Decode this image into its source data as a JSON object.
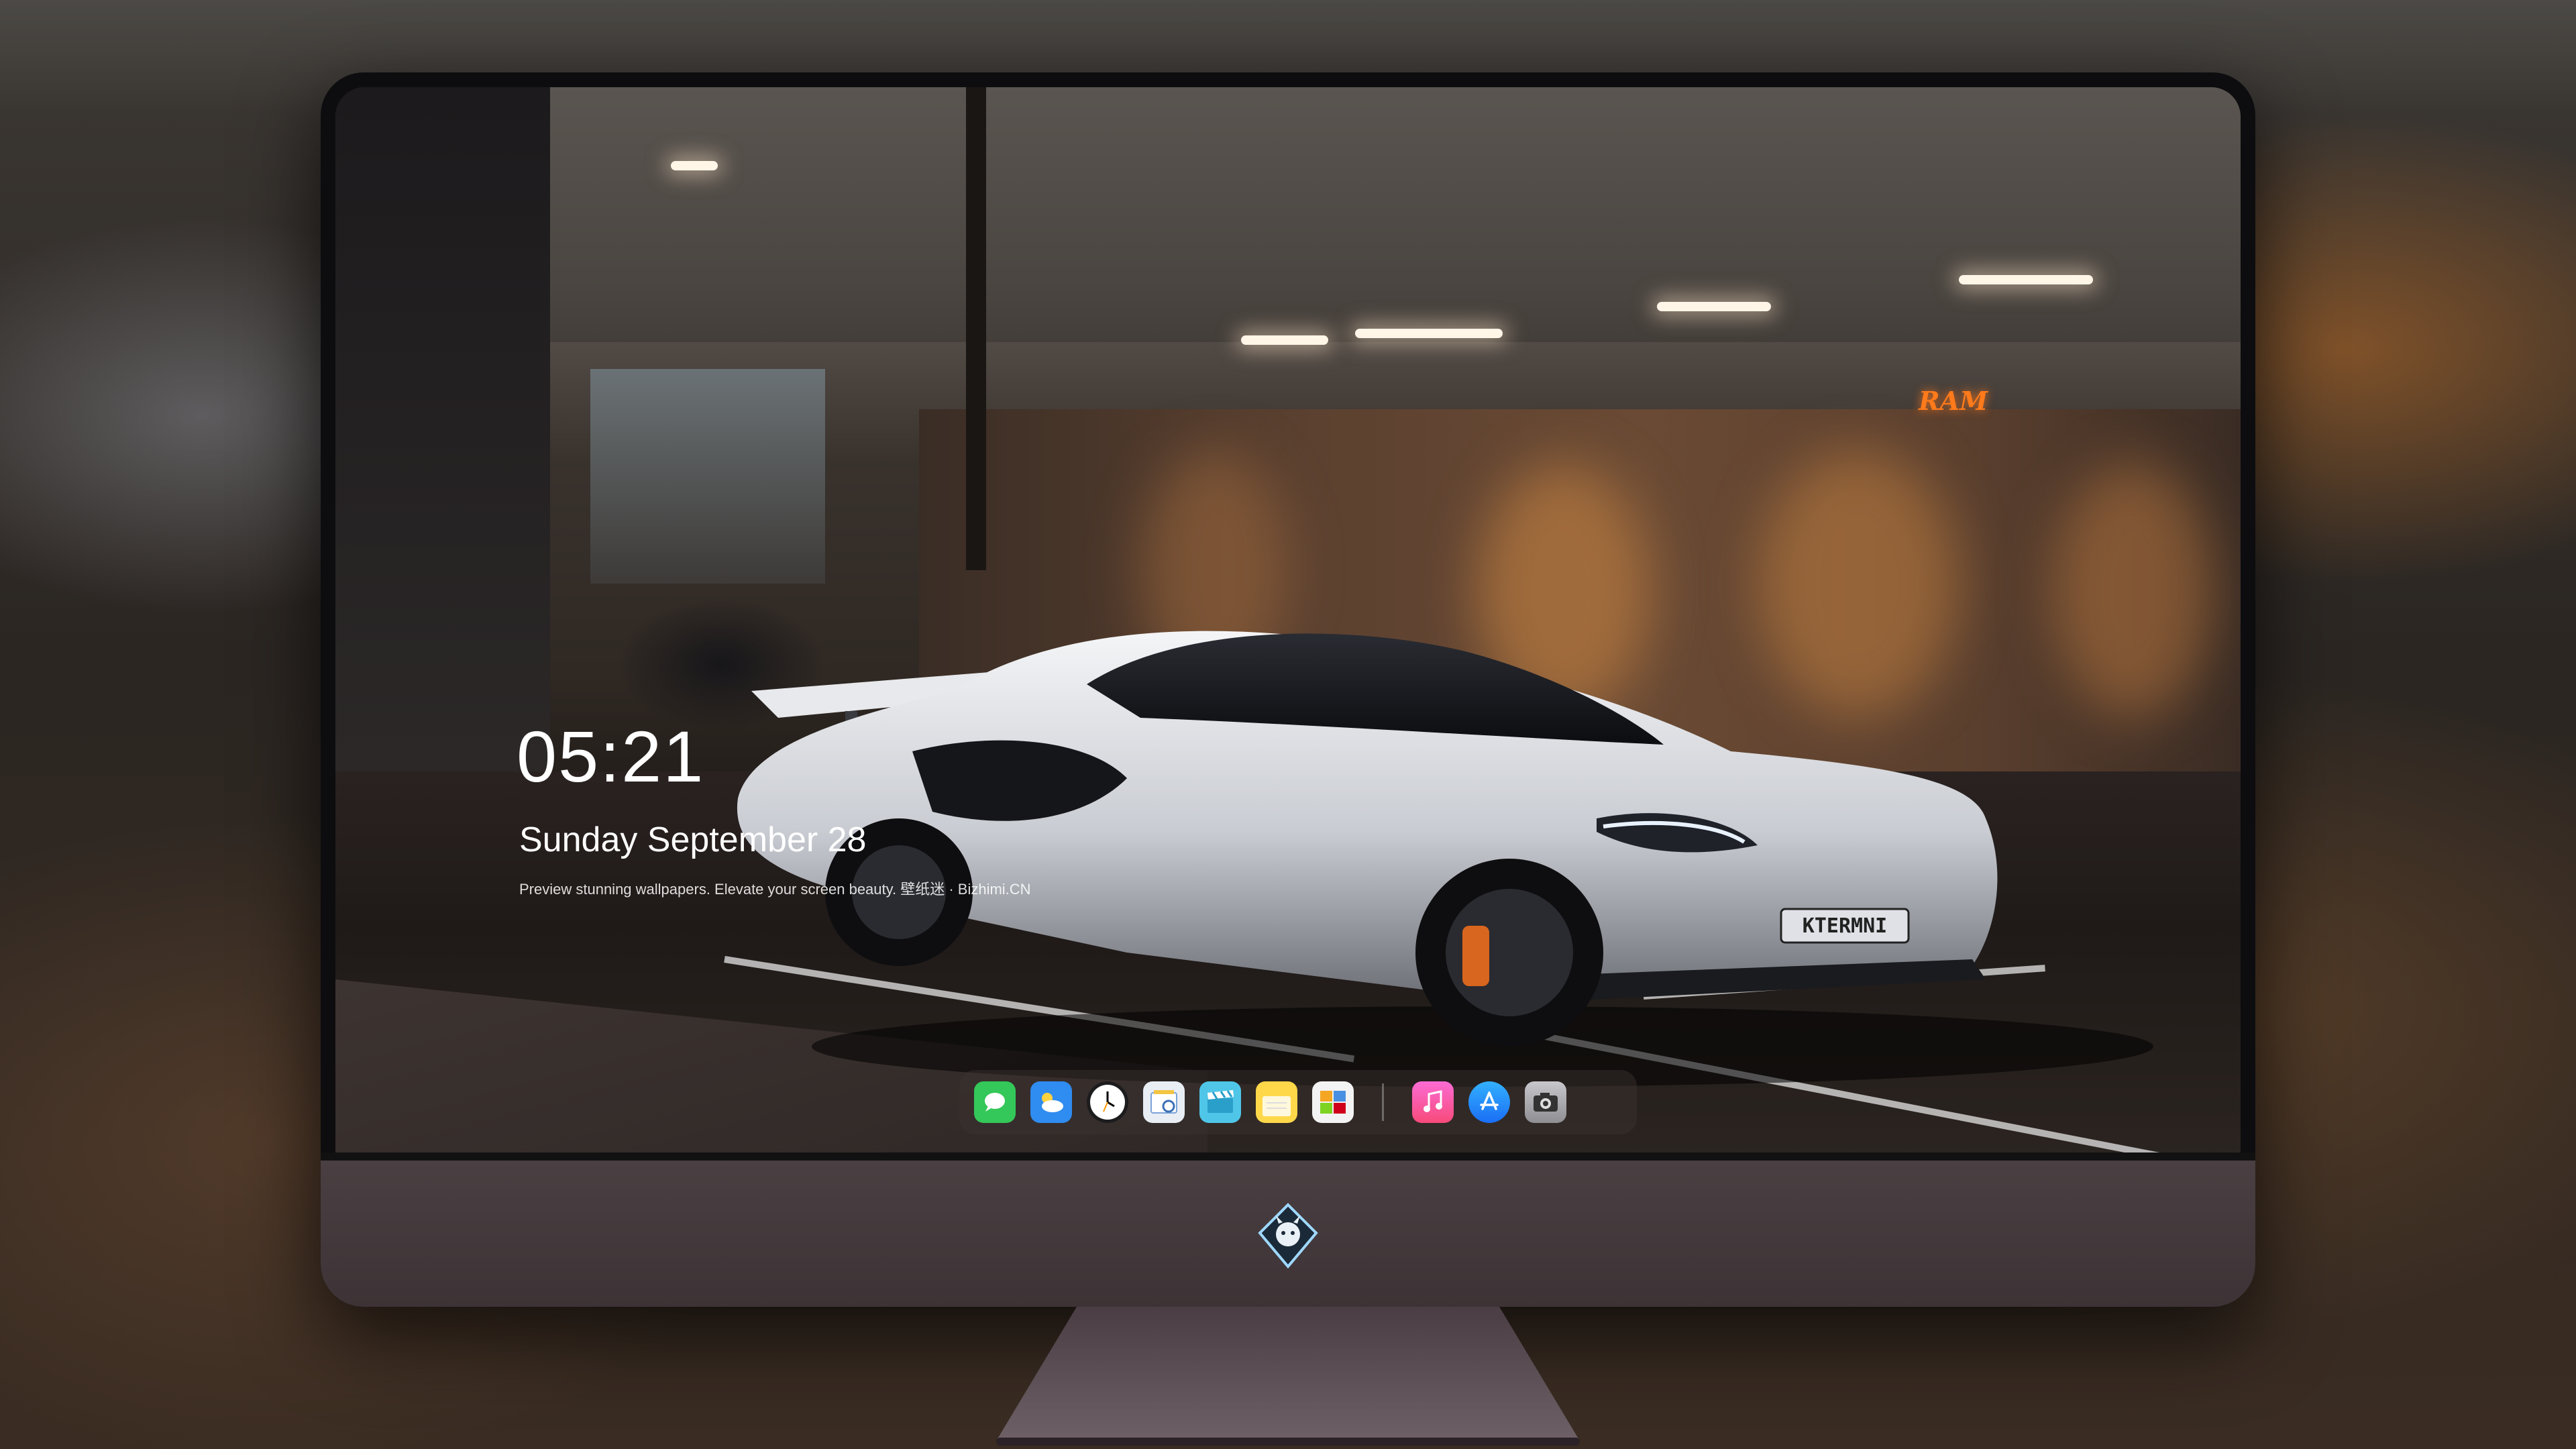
{
  "lock_screen": {
    "time": "05:21",
    "date": "Sunday September  28",
    "tagline": "Preview stunning wallpapers. Elevate your screen beauty. 壁纸迷 · Bizhimi.CN"
  },
  "wallpaper": {
    "sign_text": "RAM",
    "license_plate": "KTERMNI"
  },
  "dock": {
    "apps": [
      {
        "icon": "messages-icon",
        "color": "#34c759"
      },
      {
        "icon": "weather-icon",
        "color": "#2f8cf0"
      },
      {
        "icon": "clock-icon",
        "color": "#1c1c1e"
      },
      {
        "icon": "preview-icon",
        "color": "#e9eef5"
      },
      {
        "icon": "clips-icon",
        "color": "#4fc6e8"
      },
      {
        "icon": "notes-icon",
        "color": "#ffd84a"
      },
      {
        "icon": "photo-booth-icon",
        "color": "#f3f3f3"
      }
    ],
    "pinned": [
      {
        "icon": "music-icon",
        "color": "#fb5bc5"
      },
      {
        "icon": "app-store-icon",
        "color": "#1e8ef7"
      },
      {
        "icon": "camera-icon",
        "color": "#8e8e93"
      }
    ]
  },
  "colors": {
    "chin": "#3d3336",
    "bezel": "#0d0d0f",
    "sign_glow": "#ff7a1a"
  }
}
